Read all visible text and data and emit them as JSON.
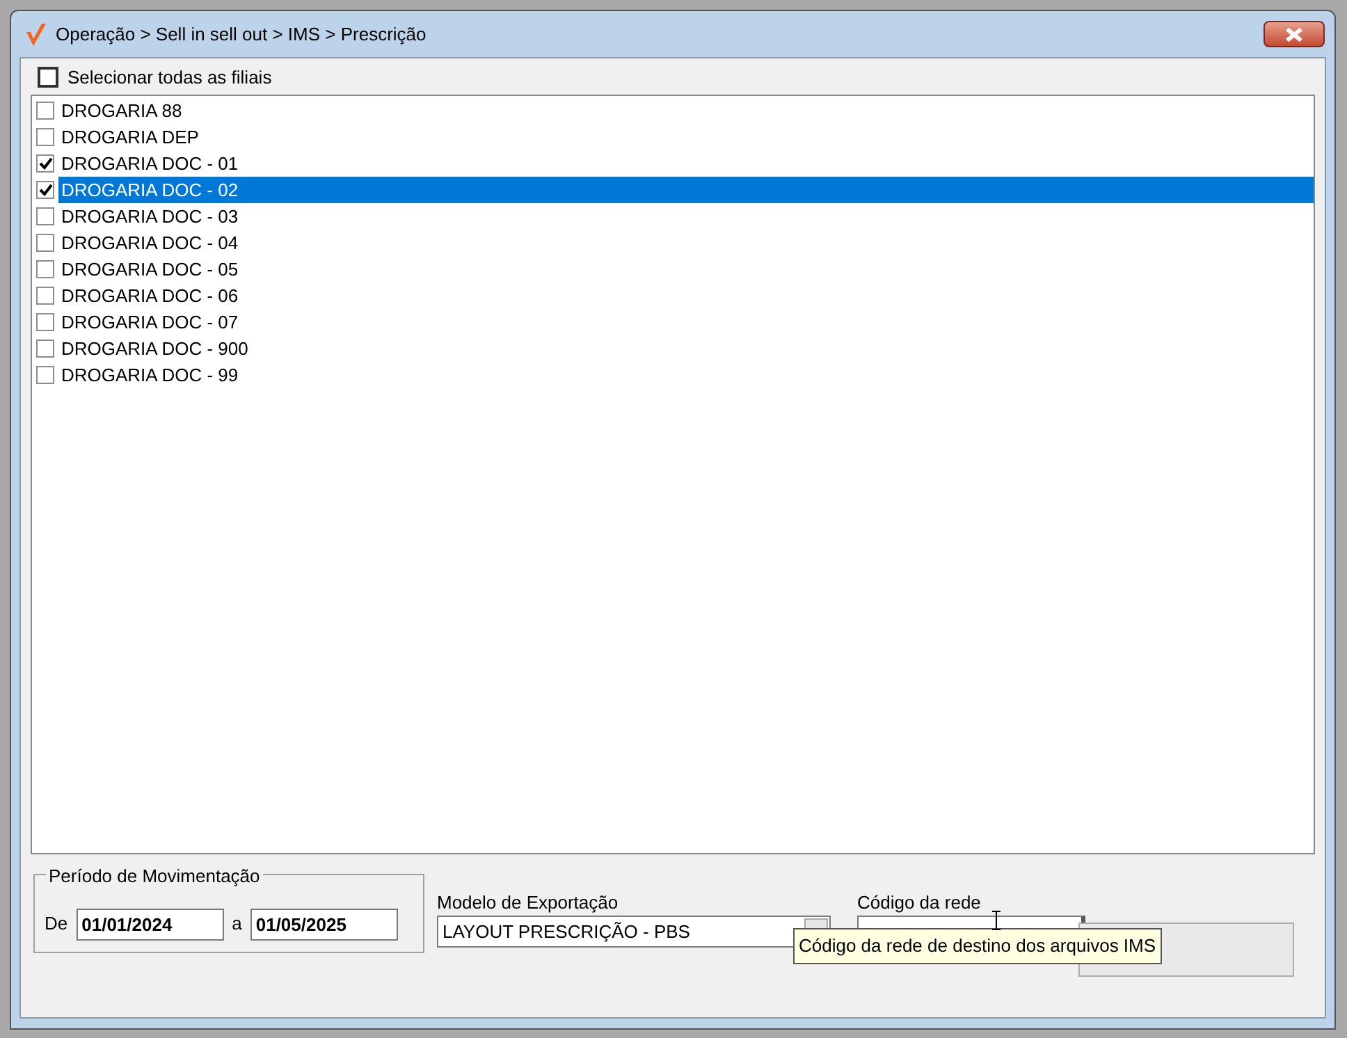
{
  "window": {
    "title": "Operação > Sell in sell out > IMS > Prescrição"
  },
  "select_all": {
    "label": "Selecionar todas as filiais",
    "checked": false
  },
  "branches": [
    {
      "name": "DROGARIA 88",
      "checked": false,
      "selected": false
    },
    {
      "name": "DROGARIA DEP",
      "checked": false,
      "selected": false
    },
    {
      "name": "DROGARIA DOC - 01",
      "checked": true,
      "selected": false
    },
    {
      "name": "DROGARIA DOC - 02",
      "checked": true,
      "selected": true
    },
    {
      "name": "DROGARIA DOC - 03",
      "checked": false,
      "selected": false
    },
    {
      "name": "DROGARIA DOC - 04",
      "checked": false,
      "selected": false
    },
    {
      "name": "DROGARIA DOC - 05",
      "checked": false,
      "selected": false
    },
    {
      "name": "DROGARIA DOC - 06",
      "checked": false,
      "selected": false
    },
    {
      "name": "DROGARIA DOC - 07",
      "checked": false,
      "selected": false
    },
    {
      "name": "DROGARIA DOC - 900",
      "checked": false,
      "selected": false
    },
    {
      "name": "DROGARIA DOC - 99",
      "checked": false,
      "selected": false
    }
  ],
  "period": {
    "title": "Período de Movimentação",
    "from_label": "De",
    "from": "01/01/2024",
    "to_label": "a",
    "to": "01/05/2025"
  },
  "export_model": {
    "label": "Modelo de Exportação",
    "value": "LAYOUT PRESCRIÇÃO - PBS"
  },
  "network_code": {
    "label": "Código da rede"
  },
  "tooltip": "Código da rede de destino dos arquivos IMS"
}
